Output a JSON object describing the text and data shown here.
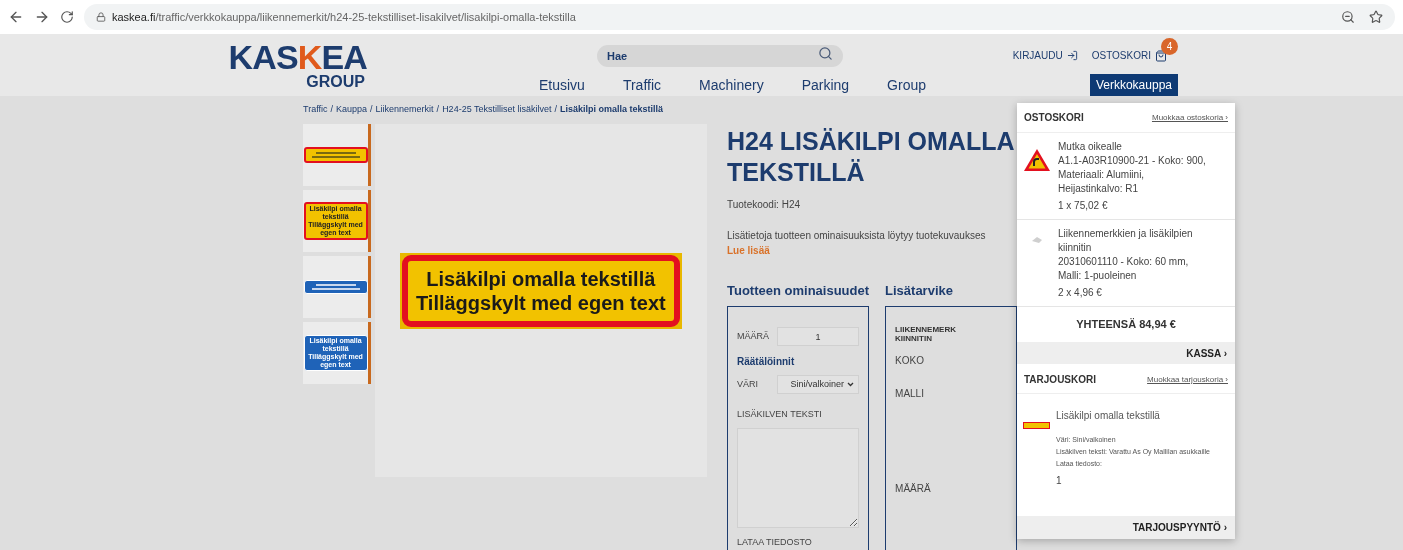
{
  "browser": {
    "url_host": "kaskea.fi",
    "url_path": "/traffic/verkkokauppa/liikennemerkit/h24-25-tekstilliset-lisakilvet/lisakilpi-omalla-tekstilla"
  },
  "header": {
    "logo_top": "KAS",
    "logo_mark": "K",
    "logo_rest": "EA",
    "logo_sub": "GROUP",
    "search": {
      "placeholder": "Hae"
    },
    "nav": [
      {
        "label": "Etusivu",
        "selected": false
      },
      {
        "label": "Traffic",
        "selected": false
      },
      {
        "label": "Machinery",
        "selected": false
      },
      {
        "label": "Parking",
        "selected": false
      },
      {
        "label": "Group",
        "selected": false
      }
    ],
    "login": "KIRJAUDU",
    "cart": "OSTOSKORI",
    "cart_count": "4",
    "shop_button": "Verkkokauppa"
  },
  "breadcrumb": [
    {
      "label": "Traffic",
      "current": false,
      "separator": "/"
    },
    {
      "label": "Kauppa",
      "current": false,
      "separator": "/"
    },
    {
      "label": "Liikennemerkit",
      "current": false,
      "separator": "/"
    },
    {
      "label": "H24-25 Tekstilliset lisäkilvet",
      "current": false,
      "separator": "/"
    },
    {
      "label": "Lisäkilpi omalla tekstillä",
      "current": true
    }
  ],
  "thumbnails": [
    {
      "color": "#f2c200",
      "kind": "wide"
    },
    {
      "color": "#f2c200",
      "lines": [
        "Lisäkilpi omalla",
        "tekstillä",
        "Tilläggskylt med",
        "egen text"
      ],
      "kind": "tall"
    },
    {
      "color": "#1f63b8",
      "kind": "wide"
    },
    {
      "color": "#1f63b8",
      "lines": [
        "Lisäkilpi omalla",
        "tekstillä",
        "Tilläggskylt med",
        "egen text"
      ],
      "kind": "tall"
    }
  ],
  "main_sign": {
    "lines": [
      "Lisäkilpi omalla tekstillä",
      "Tilläggskylt med egen text"
    ]
  },
  "product": {
    "title": "H24 LISÄKILPI OMALLA TEKSTILLÄ",
    "code": "Tuotekoodi: H24",
    "info": "Lisätietoja tuotteen ominaisuuksista löytyy tuotekuvaukses",
    "read_more": "Lue lisää",
    "properties": {
      "heading": "Tuotteen ominaisuudet",
      "qty_label": "MÄÄRÄ",
      "qty_value": "1",
      "custom_heading": "Räätälöinnit",
      "color_label": "VÄRI",
      "color_value": "Sini/valkoiner",
      "text_label": "LISÄKILVEN TEKSTI",
      "upload_label": "LATAA TIEDOSTO"
    },
    "accessory": {
      "heading": "Lisätarvike",
      "name_lines": [
        "LIIKENNEMERK",
        "KIINNITIN"
      ],
      "size_label": "KOKO",
      "model_label": "MALLI",
      "qty_label": "MÄÄRÄ"
    }
  },
  "cart_dropdown": {
    "title": "OSTOSKORI",
    "edit_link": "Muokkaa ostoskoria ›",
    "items": [
      {
        "kind": "sign",
        "name": "Mutka oikealle",
        "details": "A1.1-A03R10900-21 - Koko: 900, Materiaali: Alumiini, Heijastinkalvo: R1",
        "price": "1 x 75,02 €"
      },
      {
        "kind": "bracket",
        "name": "Liikennemerkkien ja lisäkilpien kiinnitin",
        "details": "20310601110 - Koko: 60 mm, Malli: 1-puoleinen",
        "price": "2 x 4,96 €"
      }
    ],
    "total": "YHTEENSÄ 84,94 €",
    "checkout": "KASSA ›",
    "quote_title": "TARJOUSKORI",
    "quote_edit_link": "Muokkaa tarjouskoria ›",
    "quote_item": {
      "name": "Lisäkilpi omalla tekstillä",
      "details": [
        "Väri: Sini/valkoinen",
        "Lisäkilven teksti: Varattu As Oy Mallilan asukkaille",
        "Lataa tiedosto:"
      ],
      "qty": "1"
    },
    "quote_button": "TARJOUSPYYNTÖ ›"
  }
}
